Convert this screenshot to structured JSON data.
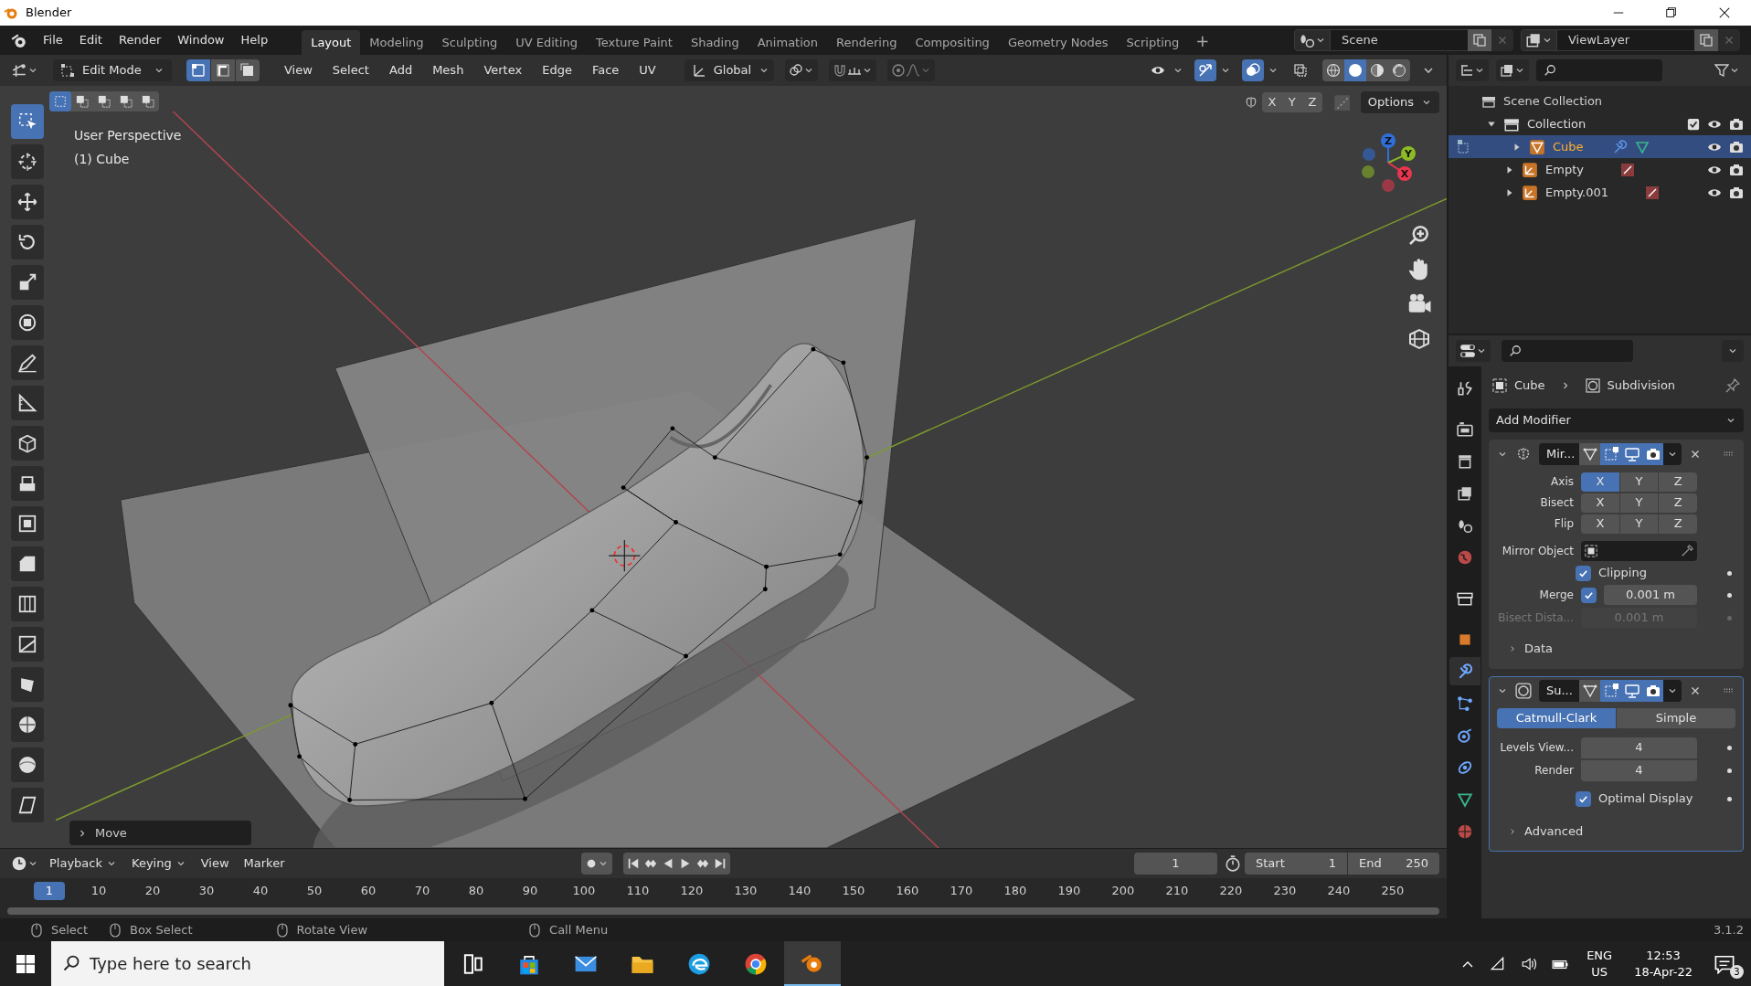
{
  "window": {
    "title": "Blender"
  },
  "menu": [
    "File",
    "Edit",
    "Render",
    "Window",
    "Help"
  ],
  "workspaces": [
    {
      "label": "Layout",
      "selected": true
    },
    {
      "label": "Modeling",
      "selected": false
    },
    {
      "label": "Sculpting",
      "selected": false
    },
    {
      "label": "UV Editing",
      "selected": false
    },
    {
      "label": "Texture Paint",
      "selected": false
    },
    {
      "label": "Shading",
      "selected": false
    },
    {
      "label": "Animation",
      "selected": false
    },
    {
      "label": "Rendering",
      "selected": false
    },
    {
      "label": "Compositing",
      "selected": false
    },
    {
      "label": "Geometry Nodes",
      "selected": false
    },
    {
      "label": "Scripting",
      "selected": false
    }
  ],
  "add_workspace": "+",
  "scene": "Scene",
  "view_layer": "ViewLayer",
  "viewport_header": {
    "mode": "Edit Mode",
    "select_modes": [
      {
        "kind": "vertex",
        "selected": true
      },
      {
        "kind": "edge",
        "selected": false
      },
      {
        "kind": "face",
        "selected": false
      }
    ],
    "menus": [
      "View",
      "Select",
      "Add",
      "Mesh",
      "Vertex",
      "Edge",
      "Face",
      "UV"
    ],
    "orientation": "Global"
  },
  "viewport_tools": {
    "box_modes": [
      {
        "selected": true
      },
      {
        "selected": false
      },
      {
        "selected": false
      },
      {
        "selected": false
      },
      {
        "selected": false
      }
    ],
    "mirror_axes": [
      "X",
      "Y",
      "Z"
    ],
    "options": "Options"
  },
  "viewport": {
    "info": [
      "User Perspective",
      "(1) Cube"
    ],
    "gizmo_axes": [
      {
        "label": "Z",
        "color": "#2f6fdc"
      },
      {
        "label": "Y",
        "color": "#8cbb24"
      },
      {
        "label": "X",
        "color": "#e8364f"
      }
    ],
    "last_operator": "Move"
  },
  "toolbar": {
    "tools": [
      {
        "kind": "select",
        "selected": true
      },
      {
        "kind": "cursor",
        "selected": false
      },
      {
        "kind": "move",
        "selected": false
      },
      {
        "kind": "rotate",
        "selected": false
      },
      {
        "kind": "scale",
        "selected": false
      },
      {
        "kind": "transform",
        "selected": false
      },
      {
        "kind": "annotate",
        "selected": false
      },
      {
        "kind": "measure",
        "selected": false
      },
      {
        "kind": "add-cube",
        "selected": false
      },
      {
        "kind": "extrude",
        "selected": false
      },
      {
        "kind": "inset",
        "selected": false
      },
      {
        "kind": "bevel",
        "selected": false
      },
      {
        "kind": "loop-cut",
        "selected": false
      },
      {
        "kind": "knife",
        "selected": false
      },
      {
        "kind": "poly-build",
        "selected": false
      },
      {
        "kind": "spin",
        "selected": false
      },
      {
        "kind": "smooth",
        "selected": false
      },
      {
        "kind": "shear",
        "selected": false
      }
    ]
  },
  "outliner": {
    "root": "Scene Collection",
    "tree": [
      {
        "label": "Collection",
        "kind": "collection",
        "selected": false,
        "expanded": true,
        "children": [
          {
            "label": "Cube",
            "kind": "mesh",
            "selected": true,
            "expanded": false
          },
          {
            "label": "Empty",
            "kind": "empty",
            "selected": false,
            "expanded": false
          },
          {
            "label": "Empty.001",
            "kind": "empty",
            "selected": false,
            "expanded": false
          }
        ]
      }
    ]
  },
  "properties": {
    "tabs": [
      {
        "kind": "tool",
        "selected": false
      },
      {
        "kind": "render",
        "selected": false
      },
      {
        "kind": "output",
        "selected": false
      },
      {
        "kind": "view-layer",
        "selected": false
      },
      {
        "kind": "scene",
        "selected": false
      },
      {
        "kind": "world",
        "selected": false
      },
      {
        "kind": "collection",
        "selected": false
      },
      {
        "kind": "object",
        "selected": false
      },
      {
        "kind": "modifier",
        "selected": true
      },
      {
        "kind": "particles",
        "selected": false
      },
      {
        "kind": "physics",
        "selected": false
      },
      {
        "kind": "constraints",
        "selected": false
      },
      {
        "kind": "data",
        "selected": false
      },
      {
        "kind": "material",
        "selected": false
      }
    ],
    "breadcrumb": [
      "Cube",
      "Subdivision"
    ],
    "add_modifier": "Add Modifier",
    "modifiers": [
      {
        "kind": "mirror",
        "name": "Mir...",
        "active": false,
        "toggles": [
          {
            "kind": "on-cage",
            "on": false
          },
          {
            "kind": "edit-mode",
            "on": true
          },
          {
            "kind": "realtime",
            "on": true
          },
          {
            "kind": "render",
            "on": true
          }
        ],
        "axis": {
          "label": "Axis",
          "options": [
            {
              "label": "X",
              "on": true
            },
            {
              "label": "Y",
              "on": false
            },
            {
              "label": "Z",
              "on": false
            }
          ]
        },
        "bisect": {
          "label": "Bisect",
          "options": [
            {
              "label": "X",
              "on": false
            },
            {
              "label": "Y",
              "on": false
            },
            {
              "label": "Z",
              "on": false
            }
          ]
        },
        "flip": {
          "label": "Flip",
          "options": [
            {
              "label": "X",
              "on": false
            },
            {
              "label": "Y",
              "on": false
            },
            {
              "label": "Z",
              "on": false
            }
          ]
        },
        "mirror_object": {
          "label": "Mirror Object"
        },
        "clipping": {
          "label": "Clipping",
          "checked": true
        },
        "merge": {
          "label": "Merge",
          "checked": true,
          "value": "0.001 m"
        },
        "bisect_distance": {
          "label": "Bisect Dista...",
          "value": "0.001 m",
          "disabled": true
        },
        "subpanel": "Data"
      },
      {
        "kind": "subdivision",
        "name": "Su...",
        "active": true,
        "toggles": [
          {
            "kind": "on-cage",
            "on": false
          },
          {
            "kind": "edit-mode",
            "on": true
          },
          {
            "kind": "realtime",
            "on": true
          },
          {
            "kind": "render",
            "on": true
          }
        ],
        "types": [
          {
            "label": "Catmull-Clark",
            "selected": true
          },
          {
            "label": "Simple",
            "selected": false
          }
        ],
        "levels_viewport": {
          "label": "Levels View...",
          "value": "4"
        },
        "render": {
          "label": "Render",
          "value": "4"
        },
        "optimal_display": {
          "label": "Optimal Display",
          "checked": true
        },
        "subpanel": "Advanced"
      }
    ]
  },
  "timeline": {
    "menus": [
      "Playback",
      "Keying",
      "View",
      "Marker"
    ],
    "current_frame": "1",
    "start_label": "Start",
    "start": "1",
    "end_label": "End",
    "end": "250",
    "ruler": [
      {
        "label": "1",
        "selected": true
      },
      {
        "label": "10",
        "selected": false
      },
      {
        "label": "20",
        "selected": false
      },
      {
        "label": "30",
        "selected": false
      },
      {
        "label": "40",
        "selected": false
      },
      {
        "label": "50",
        "selected": false
      },
      {
        "label": "60",
        "selected": false
      },
      {
        "label": "70",
        "selected": false
      },
      {
        "label": "80",
        "selected": false
      },
      {
        "label": "90",
        "selected": false
      },
      {
        "label": "100",
        "selected": false
      },
      {
        "label": "110",
        "selected": false
      },
      {
        "label": "120",
        "selected": false
      },
      {
        "label": "130",
        "selected": false
      },
      {
        "label": "140",
        "selected": false
      },
      {
        "label": "150",
        "selected": false
      },
      {
        "label": "160",
        "selected": false
      },
      {
        "label": "170",
        "selected": false
      },
      {
        "label": "180",
        "selected": false
      },
      {
        "label": "190",
        "selected": false
      },
      {
        "label": "200",
        "selected": false
      },
      {
        "label": "210",
        "selected": false
      },
      {
        "label": "220",
        "selected": false
      },
      {
        "label": "230",
        "selected": false
      },
      {
        "label": "240",
        "selected": false
      },
      {
        "label": "250",
        "selected": false
      }
    ]
  },
  "status_bar": {
    "hints": [
      "Select",
      "Box Select",
      "Rotate View",
      "Call Menu"
    ],
    "version": "3.1.2"
  },
  "taskbar": {
    "search_placeholder": "Type here to search",
    "apps": [
      {
        "kind": "task-view",
        "selected": false
      },
      {
        "kind": "store",
        "selected": false
      },
      {
        "kind": "mail",
        "selected": false
      },
      {
        "kind": "folder",
        "selected": false
      },
      {
        "kind": "edge",
        "selected": false
      },
      {
        "kind": "chrome",
        "selected": false
      },
      {
        "kind": "blender",
        "selected": true
      }
    ],
    "language": [
      "ENG",
      "US"
    ],
    "time": "12:53",
    "date": "18-Apr-22",
    "notifications": "3"
  }
}
